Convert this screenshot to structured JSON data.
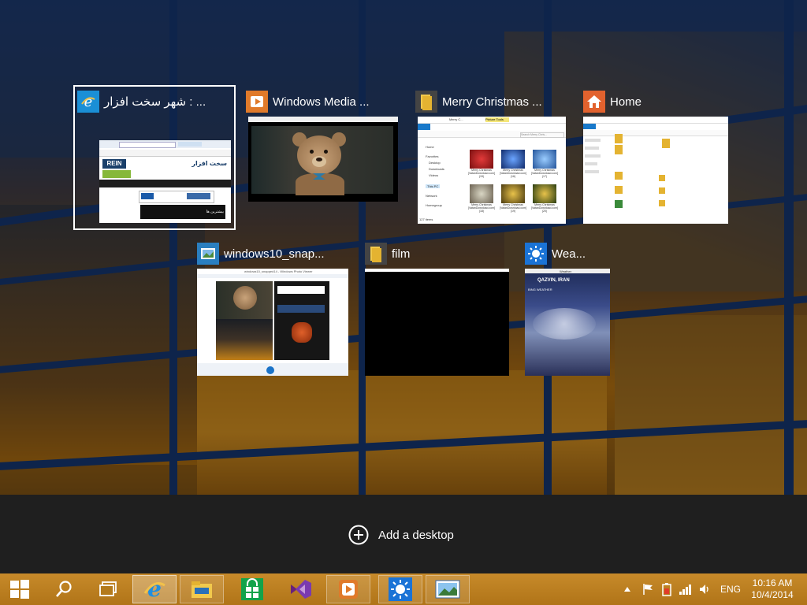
{
  "task_view": {
    "windows": [
      {
        "id": "ie",
        "title": "شهر سخت افزار : ...",
        "icon": "internet-explorer-icon",
        "selected": true,
        "thumb_texts": {
          "logo": "REIN",
          "site": "سخت افزار",
          "caption": "بیشترین ها"
        }
      },
      {
        "id": "wmp",
        "title": "Windows Media ...",
        "icon": "windows-media-player-icon",
        "selected": false
      },
      {
        "id": "christmas",
        "title": "Merry Christmas ...",
        "icon": "folder-icon",
        "selected": false,
        "thumb_texts": {
          "tab": "Picture Tools",
          "path": "Merry C...",
          "search": "Search Merry Chris...",
          "items": "127 items",
          "nav": [
            "Home",
            "Favorites",
            "Desktop",
            "Downloads",
            "Videos",
            "This PC",
            "Network",
            "Homegroup"
          ],
          "captions": [
            "Merry Christmas [VatanDownload.com] (15)",
            "Merry Christmas [VatanDownload.com] (16)",
            "Merry Christmas [VatanDownload.com] (17)",
            "Merry Christmas [VatanDownload.com] (18)",
            "Merry Christmas [VatanDownload.com] (19)",
            "Merry Christmas [VatanDownload.com] (20)"
          ]
        }
      },
      {
        "id": "home",
        "title": "Home",
        "icon": "home-folder-icon",
        "selected": false
      },
      {
        "id": "snap",
        "title": "windows10_snap...",
        "icon": "photo-viewer-icon",
        "selected": false,
        "thumb_texts": {
          "caption": "windows10_snapped14 - Windows Photo Viewer"
        }
      },
      {
        "id": "film",
        "title": "film",
        "icon": "folder-icon",
        "selected": false
      },
      {
        "id": "weather",
        "title": "Wea...",
        "icon": "weather-sun-icon",
        "selected": false,
        "thumb_texts": {
          "header": "Weather",
          "city": "QAZVIN, IRAN",
          "cond": "BING WEATHER"
        }
      }
    ]
  },
  "add_desktop": {
    "label": "Add a desktop"
  },
  "taskbar": {
    "start": "start-button",
    "search": "search-button",
    "taskview": "task-view-button",
    "apps": [
      {
        "name": "Internet Explorer",
        "icon": "internet-explorer-icon",
        "state": "active"
      },
      {
        "name": "File Explorer",
        "icon": "file-explorer-icon",
        "state": "running"
      },
      {
        "name": "Store",
        "icon": "store-icon",
        "state": "pinned"
      },
      {
        "name": "Visual Studio",
        "icon": "visual-studio-icon",
        "state": "pinned"
      },
      {
        "name": "Windows Media Player",
        "icon": "windows-media-player-icon",
        "state": "running"
      },
      {
        "name": "Weather",
        "icon": "weather-sun-icon",
        "state": "running"
      },
      {
        "name": "Photo Viewer",
        "icon": "photo-viewer-icon",
        "state": "running"
      }
    ],
    "tray": {
      "language": "ENG",
      "time": "10:16 AM",
      "date": "10/4/2014"
    }
  },
  "colors": {
    "taskbar": "#b87c1c",
    "strip": "#1f1f1f",
    "ie_blue": "#1a8fd6",
    "accent_orange": "#e07a2a"
  }
}
